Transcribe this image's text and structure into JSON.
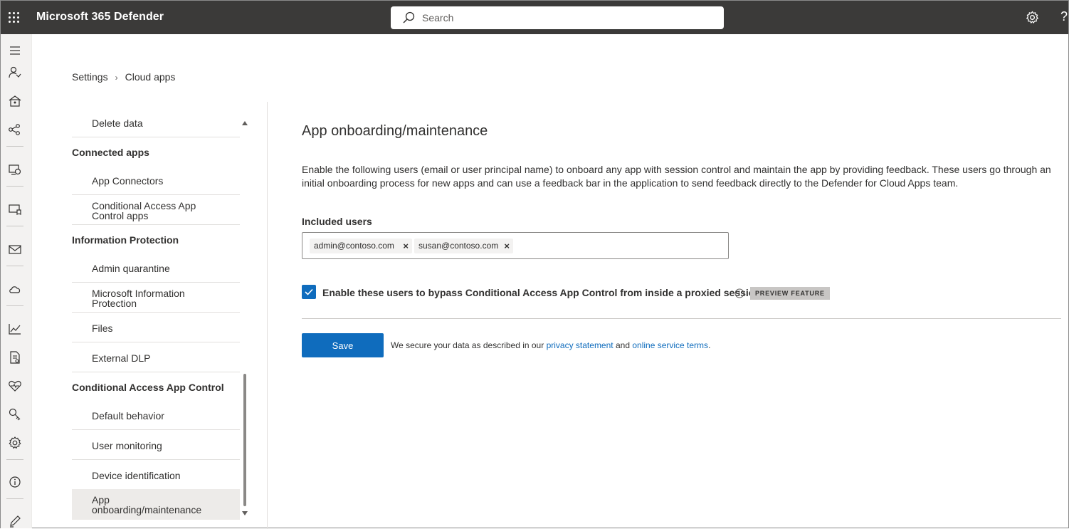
{
  "app": {
    "title": "Microsoft 365 Defender"
  },
  "search": {
    "placeholder": "Search"
  },
  "header_icons": [
    "waffle-icon",
    "gear-icon",
    "help-icon"
  ],
  "help_glyph": "?",
  "leftnav": {
    "icons": [
      "hamburger-icon",
      "incidents-icon",
      "hunting-icon",
      "actions-icon",
      "secure-score-icon",
      "endpoints-icon",
      "email-icon",
      "cloud-apps-icon",
      "reports-icon",
      "audit-icon",
      "health-icon",
      "permissions-icon",
      "settings-icon",
      "info-icon",
      "customize-icon"
    ]
  },
  "breadcrumb": {
    "root": "Settings",
    "separator": "›",
    "current": "Cloud apps"
  },
  "settings_nav": {
    "items": [
      {
        "type": "item",
        "label": "Delete data"
      },
      {
        "type": "group",
        "label": "Connected apps"
      },
      {
        "type": "item",
        "label": "App Connectors"
      },
      {
        "type": "item",
        "label": "Conditional Access App Control apps"
      },
      {
        "type": "group",
        "label": "Information Protection"
      },
      {
        "type": "item",
        "label": "Admin quarantine"
      },
      {
        "type": "item",
        "label": "Microsoft Information Protection"
      },
      {
        "type": "item",
        "label": "Files"
      },
      {
        "type": "item",
        "label": "External DLP"
      },
      {
        "type": "group",
        "label": "Conditional Access App Control"
      },
      {
        "type": "item",
        "label": "Default behavior"
      },
      {
        "type": "item",
        "label": "User monitoring"
      },
      {
        "type": "item",
        "label": "Device identification"
      },
      {
        "type": "item",
        "label": "App onboarding/maintenance",
        "selected": true
      }
    ]
  },
  "main": {
    "title": "App onboarding/maintenance",
    "description": "Enable the following users (email or user principal name) to onboard any app with session control and maintain the app by providing feedback. These users go through an initial onboarding process for new apps and can use a feedback bar in the application to send feedback directly to the Defender for Cloud Apps team.",
    "included_users_label": "Included users",
    "included_users": [
      "admin@contoso.com",
      "susan@contoso.com"
    ],
    "chip_remove_glyph": "×",
    "bypass_checkbox": {
      "label": "Enable these users to bypass Conditional Access App Control from inside a proxied session",
      "checked": true
    },
    "preview_badge": "PREVIEW FEATURE",
    "save_label": "Save",
    "legal": {
      "prefix": "We secure your data as described in our",
      "privacy_link": "privacy statement",
      "conjunction": "and",
      "terms_link": "online service terms",
      "suffix": "."
    }
  },
  "colors": {
    "topbar": "#3b3a39",
    "accent": "#0f6cbd",
    "nav_bg": "#f3f2f1"
  }
}
